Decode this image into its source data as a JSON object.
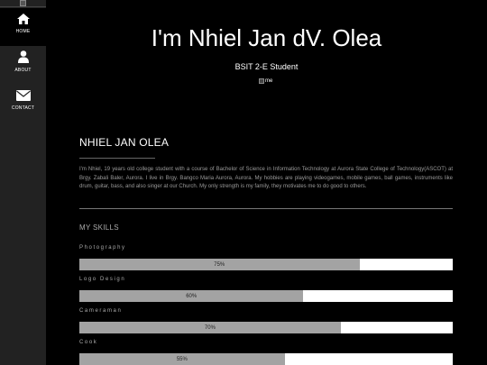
{
  "sidebar": {
    "items": [
      {
        "label": "HOME",
        "icon": "home-icon"
      },
      {
        "label": "ABOUT",
        "icon": "user-icon"
      },
      {
        "label": "CONTACT",
        "icon": "envelope-icon"
      }
    ]
  },
  "hero": {
    "title": "I'm Nhiel Jan dV. Olea",
    "subtitle": "BSIT 2-E Student",
    "image_alt": "me"
  },
  "about": {
    "title": "NHIEL JAN OLEA",
    "text": "I'm Nhiel, 19 years old college student with a course of Bachelor of Science in Information Technology at Aurora State College of Technology(ASCOT) at Brgy. Zabali Baler, Aurora. I live in Brgy. Bangco Maria Aurora, Aurora. My hobbies are playing videogames, mobile games, ball games, instruments like drum, guitar, bass, and also singer at our Church. My only strength is my family, they motivates me to do good to others."
  },
  "skills": {
    "title": "MY SKILLS",
    "items": [
      {
        "name": "Photography",
        "percent_label": "75%",
        "level": 0.75
      },
      {
        "name": "Logo Design",
        "percent_label": "60%",
        "level": 0.6
      },
      {
        "name": "Cameraman",
        "percent_label": "70%",
        "level": 0.7
      },
      {
        "name": "Cook",
        "percent_label": "55%",
        "level": 0.55
      }
    ]
  },
  "colors": {
    "background": "#000000",
    "sidebar": "#222222",
    "bar_track": "#ffffff",
    "bar_fill": "#a3a3a3"
  }
}
